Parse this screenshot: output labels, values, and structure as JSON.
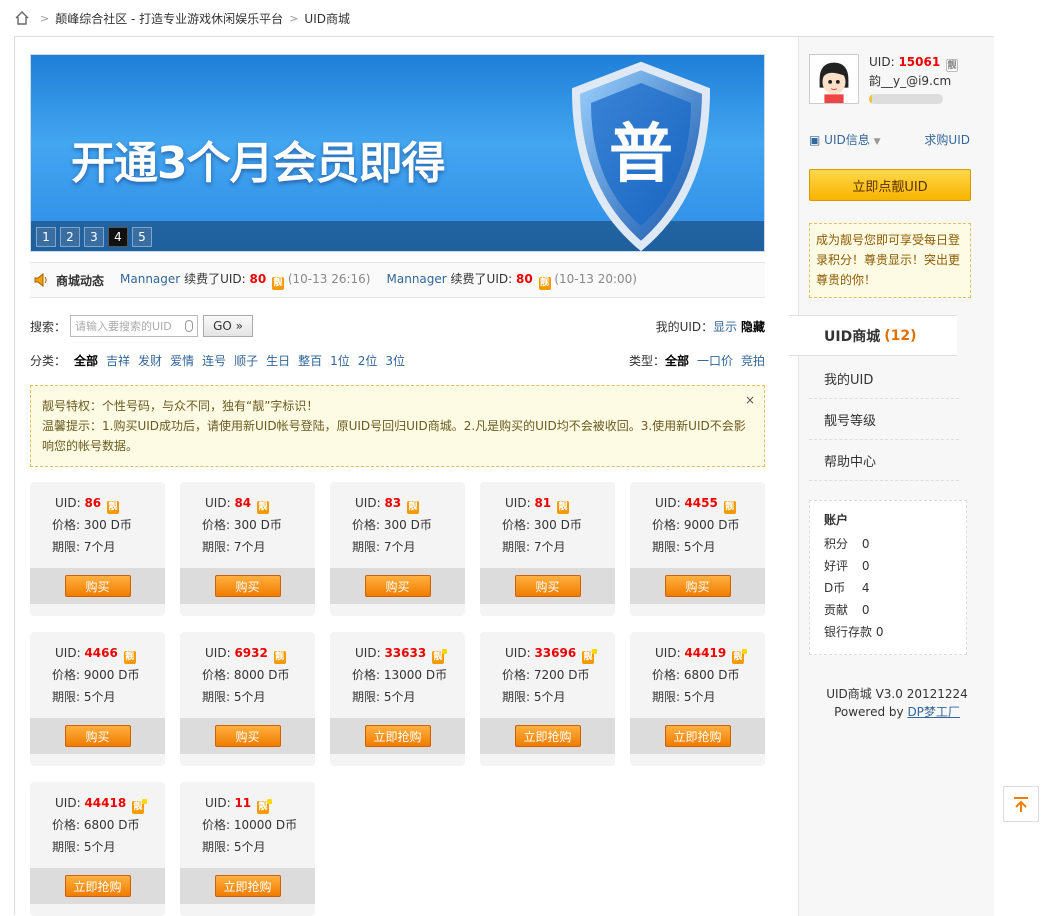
{
  "breadcrumb": {
    "home": "home-icon",
    "items": [
      "颠峰综合社区 - 打造专业游戏休闲娱乐平台",
      "UID商城"
    ]
  },
  "banner": {
    "text": "开通3个月会员即得",
    "shield_text": "普",
    "pages": [
      "1",
      "2",
      "3",
      "4",
      "5"
    ],
    "active_page": "4"
  },
  "news": {
    "title": "商城动态",
    "items": [
      {
        "user": "Mannager",
        "action": "续费了UID:",
        "uid": "80",
        "time": "(10-13 26:16)"
      },
      {
        "user": "Mannager",
        "action": "续费了UID:",
        "uid": "80",
        "time": "(10-13 20:00)"
      }
    ]
  },
  "search": {
    "label": "搜索：",
    "placeholder": "请输入要搜索的UID",
    "go": "GO »",
    "my_uid_label": "我的UID：",
    "show": "显示",
    "hide": "隐藏"
  },
  "categories": {
    "label": "分类：",
    "active": "全部",
    "items": [
      "吉祥",
      "发财",
      "爱情",
      "连号",
      "顺子",
      "生日",
      "整百",
      "1位",
      "2位",
      "3位"
    ]
  },
  "types": {
    "label": "类型：",
    "active": "全部",
    "items": [
      "一口价",
      "竞拍"
    ]
  },
  "notice": {
    "line1": "靓号特权：个性号码，与众不同，独有“靓”字标识！",
    "line2": "温馨提示：1.购买UID成功后，请使用新UID帐号登陆，原UID号回归UID商城。2.凡是购买的UID均不会被收回。3.使用新UID不会影响您的帐号数据。",
    "close": "×"
  },
  "labels": {
    "uid": "UID:",
    "price": "价格:",
    "term": "期限:",
    "unit": "D币",
    "badge": "靓"
  },
  "cards": [
    {
      "uid": "86",
      "price": "300",
      "term": "7个月",
      "btn": "购买",
      "vip": false
    },
    {
      "uid": "84",
      "price": "300",
      "term": "7个月",
      "btn": "购买",
      "vip": false
    },
    {
      "uid": "83",
      "price": "300",
      "term": "7个月",
      "btn": "购买",
      "vip": false
    },
    {
      "uid": "81",
      "price": "300",
      "term": "7个月",
      "btn": "购买",
      "vip": false
    },
    {
      "uid": "4455",
      "price": "9000",
      "term": "5个月",
      "btn": "购买",
      "vip": false
    },
    {
      "uid": "4466",
      "price": "9000",
      "term": "5个月",
      "btn": "购买",
      "vip": false
    },
    {
      "uid": "6932",
      "price": "8000",
      "term": "5个月",
      "btn": "购买",
      "vip": false
    },
    {
      "uid": "33633",
      "price": "13000",
      "term": "5个月",
      "btn": "立即抢购",
      "vip": true
    },
    {
      "uid": "33696",
      "price": "7200",
      "term": "5个月",
      "btn": "立即抢购",
      "vip": true
    },
    {
      "uid": "44419",
      "price": "6800",
      "term": "5个月",
      "btn": "立即抢购",
      "vip": true
    },
    {
      "uid": "44418",
      "price": "6800",
      "term": "5个月",
      "btn": "立即抢购",
      "vip": true
    },
    {
      "uid": "11",
      "price": "10000",
      "term": "5个月",
      "btn": "立即抢购",
      "vip": true
    }
  ],
  "user": {
    "uid_label": "UID:",
    "uid": "15061",
    "name": "韵__y_@i9.cm",
    "uid_info": "UID信息",
    "seek": "求购UID",
    "big_button": "立即点靓UID",
    "tip": "成为靓号您即可享受每日登录积分！尊贵显示！突出更尊贵的你！"
  },
  "menu": {
    "title": "UID商城",
    "count": "(12)",
    "items": [
      "我的UID",
      "靓号等级",
      "帮助中心"
    ]
  },
  "account": {
    "title": "账户",
    "rows": [
      {
        "k": "积分",
        "v": "0"
      },
      {
        "k": "好评",
        "v": "0"
      },
      {
        "k": "D币",
        "v": "4"
      },
      {
        "k": "贡献",
        "v": "0"
      },
      {
        "k": "银行存款",
        "v": "0"
      }
    ]
  },
  "footer": {
    "version": "UID商城 V3.0 20121224",
    "powered": "Powered by ",
    "author": "DP梦工厂"
  }
}
